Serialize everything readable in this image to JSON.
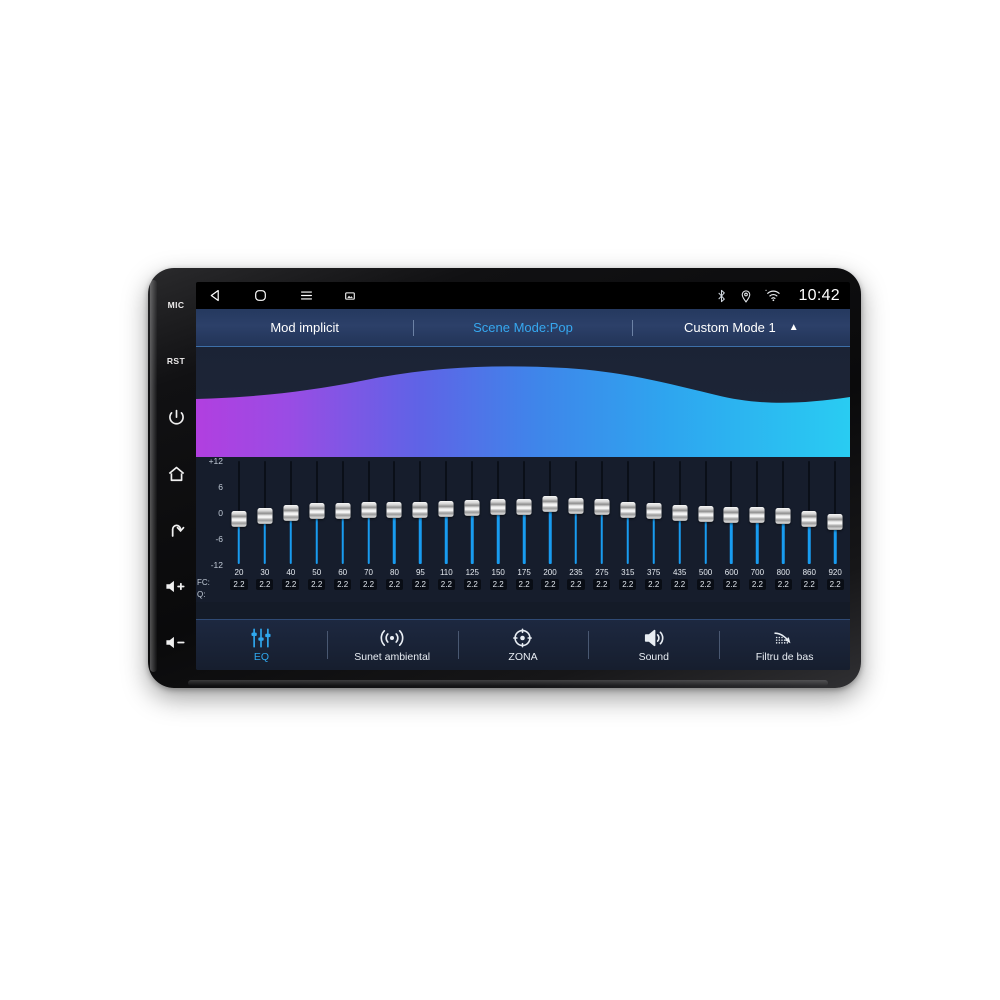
{
  "device": {
    "hard_keys": [
      {
        "name": "mic",
        "label": "MIC",
        "type": "text"
      },
      {
        "name": "reset",
        "label": "RST",
        "type": "text"
      },
      {
        "name": "power",
        "label": "",
        "type": "power-icon"
      },
      {
        "name": "home",
        "label": "",
        "type": "home-icon"
      },
      {
        "name": "back",
        "label": "",
        "type": "back-arrow-icon"
      },
      {
        "name": "volume-up",
        "label": "",
        "type": "volume-up-icon"
      },
      {
        "name": "volume-down",
        "label": "",
        "type": "volume-down-icon"
      }
    ]
  },
  "status_bar": {
    "nav_icons": [
      "back-triangle-icon",
      "home-squircle-icon",
      "menu-hamburger-icon",
      "screenshot-icon"
    ],
    "indicators": [
      "bluetooth-icon",
      "location-pin-icon",
      "wifi-icon"
    ],
    "clock": "10:42"
  },
  "mode_bar": {
    "default_mode": "Mod implicit",
    "scene_mode": "Scene Mode:Pop",
    "custom_mode": "Custom Mode 1",
    "caret": "▲",
    "active_color": "#36a8f0"
  },
  "wave": {
    "gradient_start": "#b13fe0",
    "gradient_mid": "#3f72e8",
    "gradient_end": "#29c8f0"
  },
  "equalizer": {
    "scale_labels": [
      "+12",
      "6",
      "0",
      "-6",
      "-12"
    ],
    "scale_max": 12,
    "scale_min": -12,
    "fc_row_label": "FC:",
    "q_row_label": "Q:",
    "bands": [
      {
        "fc": "20",
        "q": "2.2",
        "gain": -1.4
      },
      {
        "fc": "30",
        "q": "2.2",
        "gain": -0.6
      },
      {
        "fc": "40",
        "q": "2.2",
        "gain": 0.0
      },
      {
        "fc": "50",
        "q": "2.2",
        "gain": 0.5
      },
      {
        "fc": "60",
        "q": "2.2",
        "gain": 0.5
      },
      {
        "fc": "70",
        "q": "2.2",
        "gain": 0.6
      },
      {
        "fc": "80",
        "q": "2.2",
        "gain": 0.7
      },
      {
        "fc": "95",
        "q": "2.2",
        "gain": 0.8
      },
      {
        "fc": "110",
        "q": "2.2",
        "gain": 1.0
      },
      {
        "fc": "125",
        "q": "2.2",
        "gain": 1.1
      },
      {
        "fc": "150",
        "q": "2.2",
        "gain": 1.3
      },
      {
        "fc": "175",
        "q": "2.2",
        "gain": 1.5
      },
      {
        "fc": "200",
        "q": "2.2",
        "gain": 2.0
      },
      {
        "fc": "235",
        "q": "2.2",
        "gain": 1.6
      },
      {
        "fc": "275",
        "q": "2.2",
        "gain": 1.3
      },
      {
        "fc": "315",
        "q": "2.2",
        "gain": 0.6
      },
      {
        "fc": "375",
        "q": "2.2",
        "gain": 0.5
      },
      {
        "fc": "435",
        "q": "2.2",
        "gain": 0.0
      },
      {
        "fc": "500",
        "q": "2.2",
        "gain": -0.2
      },
      {
        "fc": "600",
        "q": "2.2",
        "gain": -0.4
      },
      {
        "fc": "700",
        "q": "2.2",
        "gain": -0.5
      },
      {
        "fc": "800",
        "q": "2.2",
        "gain": -0.6
      },
      {
        "fc": "860",
        "q": "2.2",
        "gain": -1.4
      },
      {
        "fc": "920",
        "q": "2.2",
        "gain": -2.0
      }
    ]
  },
  "bottom_nav": {
    "items": [
      {
        "label": "EQ",
        "icon": "eq-sliders-icon",
        "active": true
      },
      {
        "label": "Sunet ambiental",
        "icon": "surround-sound-icon",
        "active": false
      },
      {
        "label": "ZONA",
        "icon": "zone-target-icon",
        "active": false
      },
      {
        "label": "Sound",
        "icon": "speaker-icon",
        "active": false
      },
      {
        "label": "Filtru de bas",
        "icon": "bass-filter-icon",
        "active": false
      }
    ]
  }
}
